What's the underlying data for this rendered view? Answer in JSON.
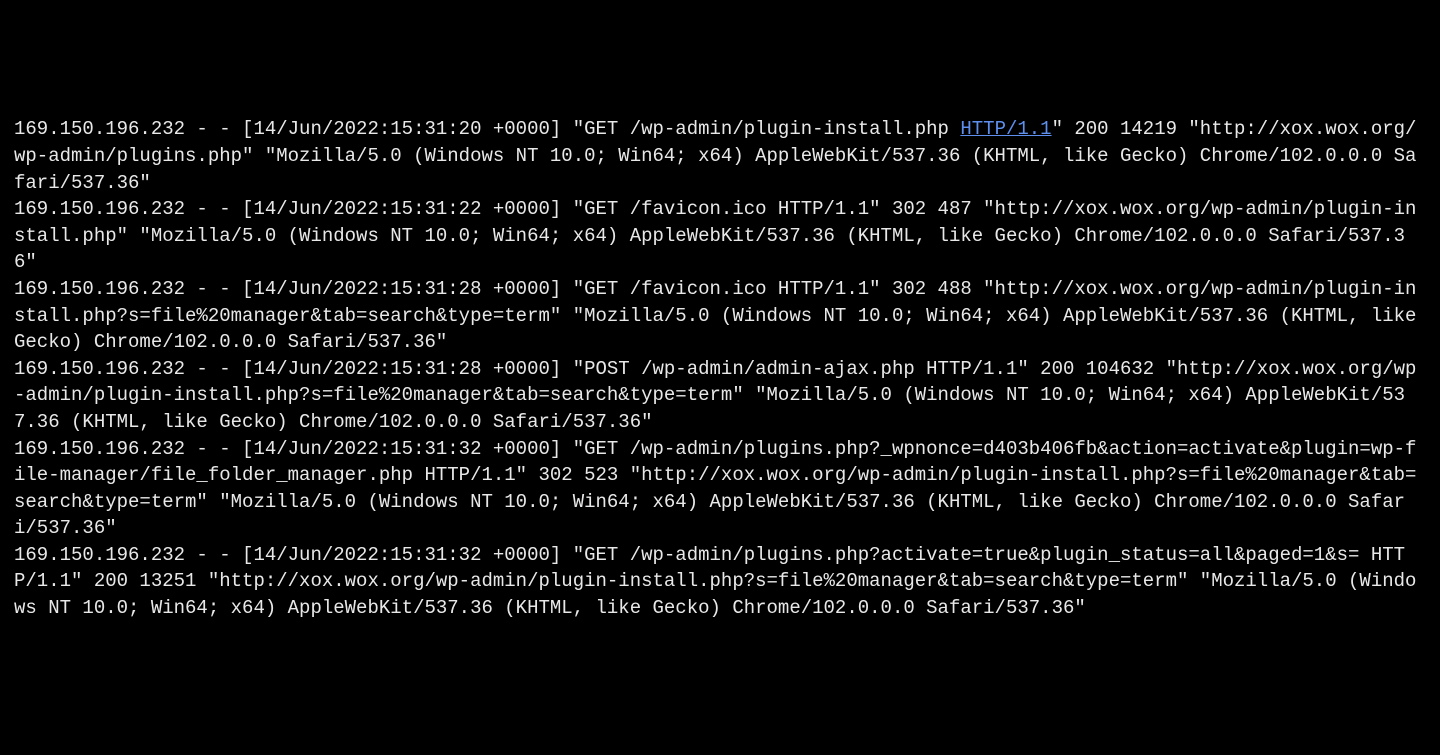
{
  "link_text": "HTTP/1.1",
  "log_entries": [
    {
      "prefix": "169.150.196.232 - - [14/Jun/2022:15:31:20 +0000] \"GET /wp-admin/plugin-install.php ",
      "has_link": true,
      "suffix": "\" 200 14219 \"http://xox.wox.org/wp-admin/plugins.php\" \"Mozilla/5.0 (Windows NT 10.0; Win64; x64) AppleWebKit/537.36 (KHTML, like Gecko) Chrome/102.0.0.0 Safari/537.36\""
    },
    {
      "prefix": "169.150.196.232 - - [14/Jun/2022:15:31:22 +0000] \"GET /favicon.ico HTTP/1.1\" 302 487 \"http://xox.wox.org/wp-admin/plugin-install.php\" \"Mozilla/5.0 (Windows NT 10.0; Win64; x64) AppleWebKit/537.36 (KHTML, like Gecko) Chrome/102.0.0.0 Safari/537.36\"",
      "has_link": false,
      "suffix": ""
    },
    {
      "prefix": "169.150.196.232 - - [14/Jun/2022:15:31:28 +0000] \"GET /favicon.ico HTTP/1.1\" 302 488 \"http://xox.wox.org/wp-admin/plugin-install.php?s=file%20manager&tab=search&type=term\" \"Mozilla/5.0 (Windows NT 10.0; Win64; x64) AppleWebKit/537.36 (KHTML, like Gecko) Chrome/102.0.0.0 Safari/537.36\"",
      "has_link": false,
      "suffix": ""
    },
    {
      "prefix": "169.150.196.232 - - [14/Jun/2022:15:31:28 +0000] \"POST /wp-admin/admin-ajax.php HTTP/1.1\" 200 104632 \"http://xox.wox.org/wp-admin/plugin-install.php?s=file%20manager&tab=search&type=term\" \"Mozilla/5.0 (Windows NT 10.0; Win64; x64) AppleWebKit/537.36 (KHTML, like Gecko) Chrome/102.0.0.0 Safari/537.36\"",
      "has_link": false,
      "suffix": ""
    },
    {
      "prefix": "169.150.196.232 - - [14/Jun/2022:15:31:32 +0000] \"GET /wp-admin/plugins.php?_wpnonce=d403b406fb&action=activate&plugin=wp-file-manager/file_folder_manager.php HTTP/1.1\" 302 523 \"http://xox.wox.org/wp-admin/plugin-install.php?s=file%20manager&tab=search&type=term\" \"Mozilla/5.0 (Windows NT 10.0; Win64; x64) AppleWebKit/537.36 (KHTML, like Gecko) Chrome/102.0.0.0 Safari/537.36\"",
      "has_link": false,
      "suffix": ""
    },
    {
      "prefix": "169.150.196.232 - - [14/Jun/2022:15:31:32 +0000] \"GET /wp-admin/plugins.php?activate=true&plugin_status=all&paged=1&s= HTTP/1.1\" 200 13251 \"http://xox.wox.org/wp-admin/plugin-install.php?s=file%20manager&tab=search&type=term\" \"Mozilla/5.0 (Windows NT 10.0; Win64; x64) AppleWebKit/537.36 (KHTML, like Gecko) Chrome/102.0.0.0 Safari/537.36\"",
      "has_link": false,
      "suffix": ""
    }
  ]
}
